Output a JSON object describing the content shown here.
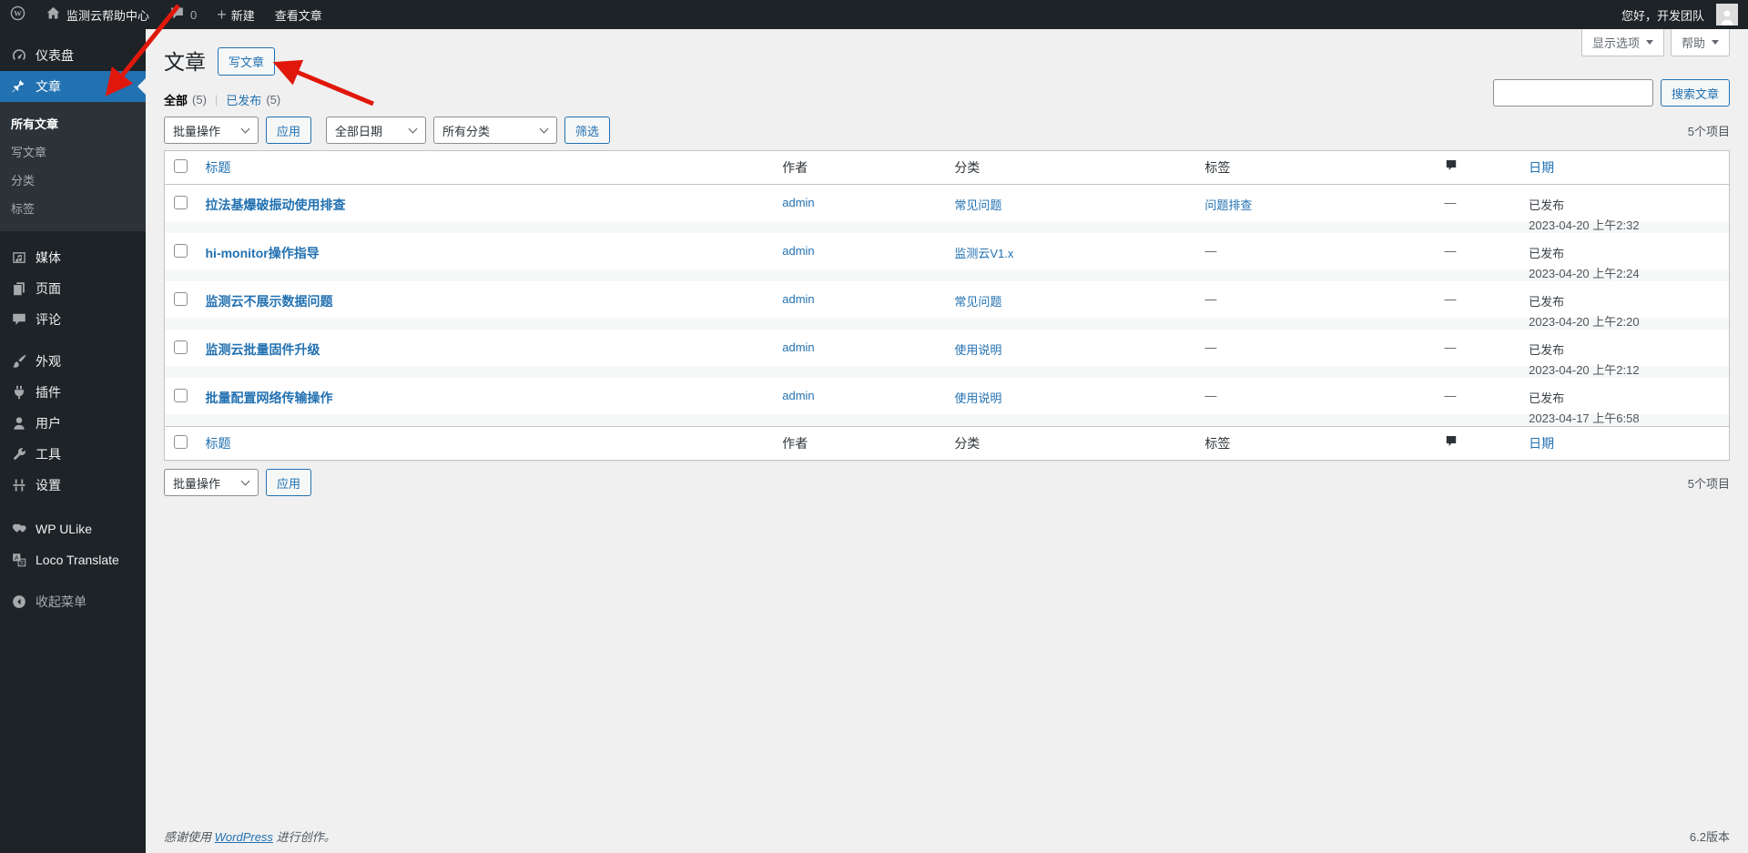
{
  "admin_bar": {
    "site_name": "监测云帮助中心",
    "comments_count": "0",
    "new_label": "新建",
    "view_posts": "查看文章",
    "greeting": "您好，开发团队"
  },
  "sidebar": {
    "dashboard": "仪表盘",
    "posts": "文章",
    "all_posts": "所有文章",
    "add_post": "写文章",
    "categories": "分类",
    "tags": "标签",
    "media": "媒体",
    "pages": "页面",
    "comments": "评论",
    "appearance": "外观",
    "plugins": "插件",
    "users": "用户",
    "tools": "工具",
    "settings": "设置",
    "wp_ulike": "WP ULike",
    "loco_translate": "Loco Translate",
    "collapse_menu": "收起菜单"
  },
  "page": {
    "title": "文章",
    "add_new": "写文章",
    "screen_options": "显示选项",
    "help": "帮助",
    "search_button": "搜索文章",
    "views": {
      "all": "全部",
      "all_count": "(5)",
      "separator": "|",
      "published": "已发布",
      "published_count": "(5)"
    }
  },
  "tablenav": {
    "bulk_actions": "批量操作",
    "apply": "应用",
    "all_dates": "全部日期",
    "all_categories": "所有分类",
    "filter": "筛选",
    "items_count": "5个项目"
  },
  "table": {
    "headers": {
      "title": "标题",
      "author": "作者",
      "category": "分类",
      "tags": "标签",
      "date": "日期"
    },
    "posts": [
      {
        "title": "拉法基爆破振动使用排查",
        "author": "admin",
        "category": "常见问题",
        "tags": "问题排查",
        "comments": "—",
        "status": "已发布",
        "date": "2023-04-20 上午2:32"
      },
      {
        "title": "hi-monitor操作指导",
        "author": "admin",
        "category": "监测云V1.x",
        "tags": "—",
        "comments": "—",
        "status": "已发布",
        "date": "2023-04-20 上午2:24"
      },
      {
        "title": "监测云不展示数据问题",
        "author": "admin",
        "category": "常见问题",
        "tags": "—",
        "comments": "—",
        "status": "已发布",
        "date": "2023-04-20 上午2:20"
      },
      {
        "title": "监测云批量固件升级",
        "author": "admin",
        "category": "使用说明",
        "tags": "—",
        "comments": "—",
        "status": "已发布",
        "date": "2023-04-20 上午2:12"
      },
      {
        "title": "批量配置网络传输操作",
        "author": "admin",
        "category": "使用说明",
        "tags": "—",
        "comments": "—",
        "status": "已发布",
        "date": "2023-04-17 上午6:58"
      }
    ]
  },
  "footer": {
    "thanks_prefix": "感谢使用",
    "wordpress_link": "WordPress",
    "thanks_suffix": "进行创作。",
    "version": "6.2版本"
  },
  "icons": {
    "wordpress_logo": "wordpress-logo-icon",
    "home": "home-icon",
    "comments_bubble": "comments-bubble-icon",
    "plus": "plus-icon",
    "dashboard": "dashboard-icon",
    "pin": "pin-icon",
    "media": "media-icon",
    "pages": "pages-icon",
    "comments": "comments-icon",
    "appearance": "appearance-icon",
    "plugins": "plugins-icon",
    "users": "users-icon",
    "tools": "tools-icon",
    "settings": "settings-icon",
    "hearts": "hearts-icon",
    "translate": "translate-icon",
    "collapse": "collapse-icon",
    "chevron_down": "chevron-down-icon"
  },
  "colors": {
    "accent": "#2271b1",
    "menu_bg": "#1d2327",
    "submenu_bg": "#2c3338",
    "content_bg": "#f0f0f1",
    "table_border": "#c3c4c7",
    "annotation_red": "#e0180c"
  }
}
